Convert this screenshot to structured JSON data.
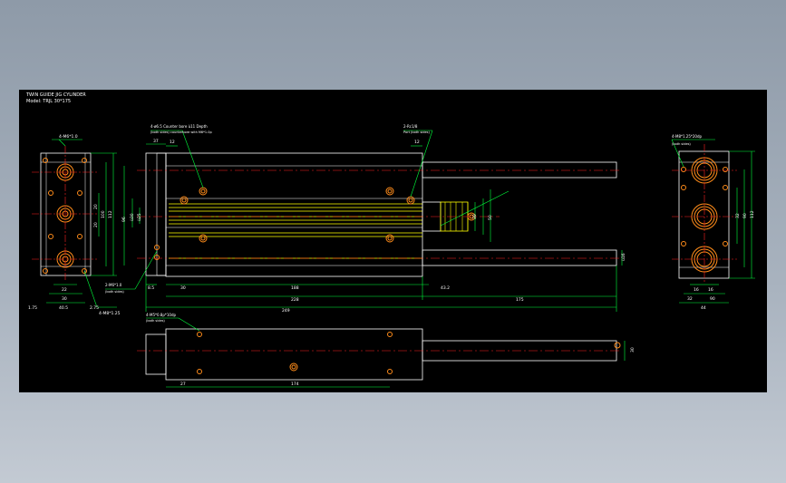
{
  "title": {
    "line1": "TWIN GUIDE JIG CYLINDER",
    "line2": "Model: TRJL 30*175"
  },
  "notes": {
    "front_holes": "4-M6*1.0",
    "bottom_holes": "4-M8*1.25",
    "bottom_holes_left": "2-M6*1.0",
    "bottom_holes_left_sub": "(both sides)",
    "counterbore": "4-ø6.5 Counter bore ù11 Depth",
    "counterbore_sub": "(both sides) counterbore with M6*1.0p",
    "port": "2-Rc1/8",
    "port_sub": "Port (both sides)",
    "right_holes": "4-M8*1.25*20dp",
    "right_holes_sub": "(both sides)",
    "bottom_view_holes": "4-M5*0.8p*10dp",
    "bottom_view_sub": "(both sides)"
  },
  "colors": {
    "outline": "#ffffff",
    "dimension": "#00ff3c",
    "centerline": "#ff2020",
    "hidden": "#ffff00",
    "holes": "#ff8c1a"
  },
  "left_view_dims": {
    "h1": "22",
    "h2": "30",
    "h3": "40.5",
    "h4": "1.75",
    "h5": "2.75",
    "v1": "20",
    "v2": "20",
    "v3": "100",
    "v4": "112"
  },
  "front_view_dims": {
    "d_rod": "ù25",
    "d_bore": "ù30",
    "d_guide": "ù16",
    "top_left": "37",
    "top_12a": "12",
    "top_12b": "12",
    "side_96": "96",
    "side_50": "50",
    "side_30": "30",
    "ret_8": "8.5",
    "b30": "30",
    "b188": "188",
    "b228": "228",
    "b43": "43.2",
    "b175": "175",
    "b249": "249",
    "right_12": "12",
    "right_8": "8"
  },
  "right_view_dims": {
    "w16a": "16",
    "w16b": "16",
    "w32": "32",
    "w90": "90",
    "w44": "44",
    "v32": "32",
    "v90": "90",
    "v112": "112"
  },
  "bottom_view_dims": {
    "d27": "27",
    "d174": "174",
    "d30": "30"
  }
}
